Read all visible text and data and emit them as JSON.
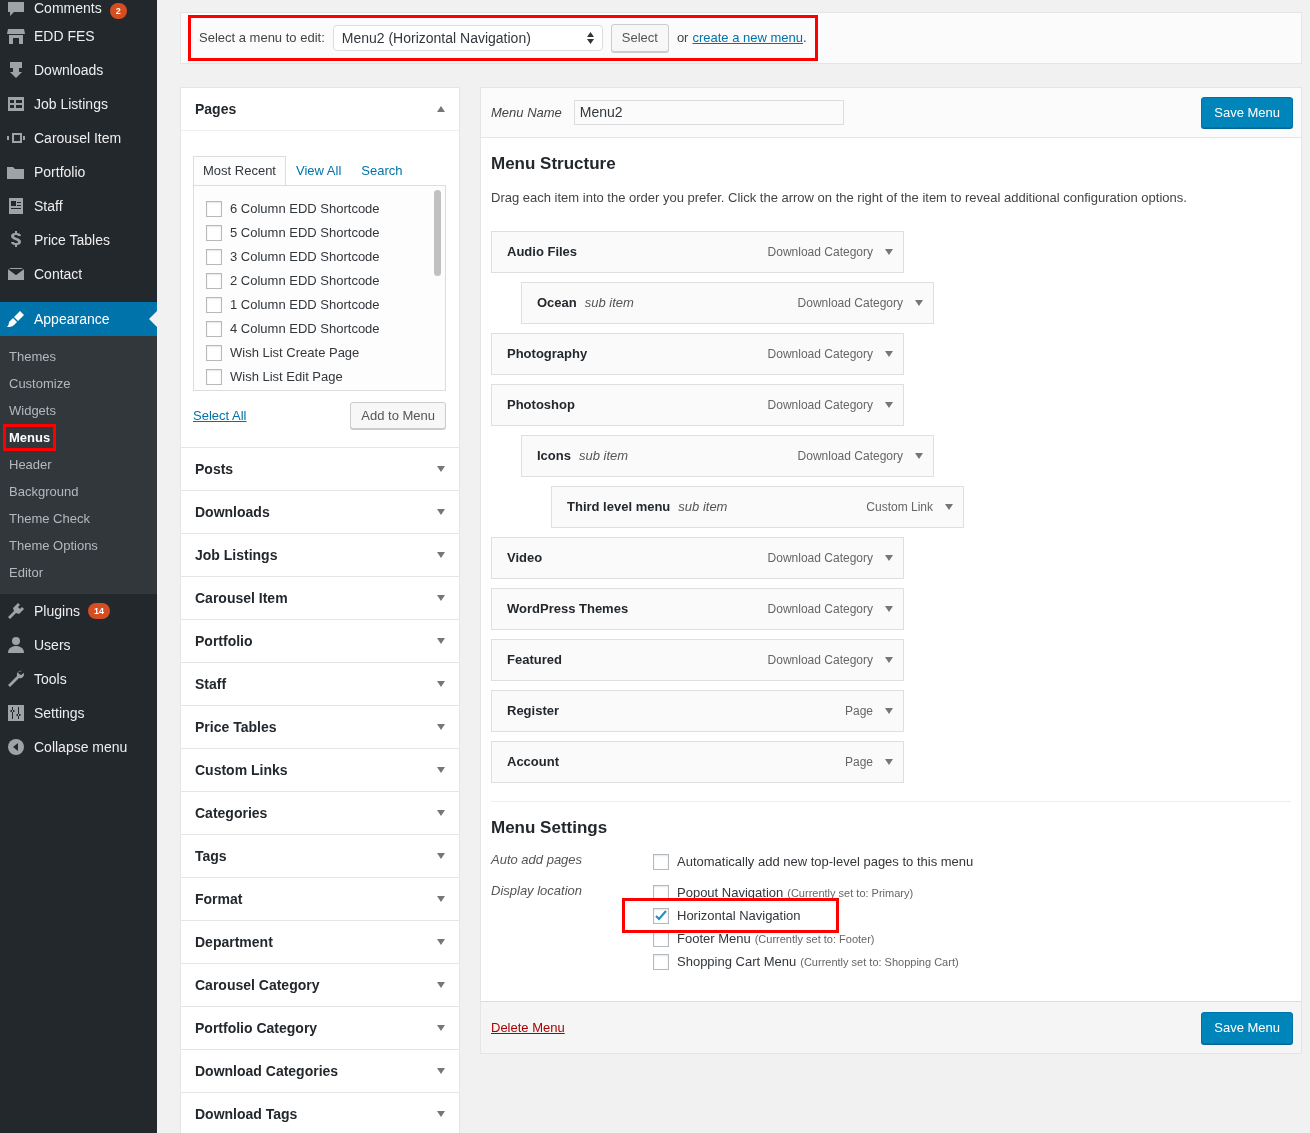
{
  "sidebar": {
    "items": [
      {
        "label": "Comments",
        "badge": "2",
        "selected": false
      },
      {
        "label": "EDD FES",
        "selected": false
      },
      {
        "label": "Downloads",
        "selected": false
      },
      {
        "label": "Job Listings",
        "selected": false
      },
      {
        "label": "Carousel Item",
        "selected": false
      },
      {
        "label": "Portfolio",
        "selected": false
      },
      {
        "label": "Staff",
        "selected": false
      },
      {
        "label": "Price Tables",
        "selected": false
      },
      {
        "label": "Contact",
        "selected": false
      },
      {
        "label": "Appearance",
        "selected": true,
        "children": [
          {
            "label": "Themes",
            "selected": false,
            "highlighted": false
          },
          {
            "label": "Customize",
            "selected": false,
            "highlighted": false
          },
          {
            "label": "Widgets",
            "selected": false,
            "highlighted": false
          },
          {
            "label": "Menus",
            "selected": true,
            "highlighted": true
          },
          {
            "label": "Header",
            "selected": false,
            "highlighted": false
          },
          {
            "label": "Background",
            "selected": false,
            "highlighted": false
          },
          {
            "label": "Theme Check",
            "selected": false,
            "highlighted": false
          },
          {
            "label": "Theme Options",
            "selected": false,
            "highlighted": false
          },
          {
            "label": "Editor",
            "selected": false,
            "highlighted": false
          }
        ]
      },
      {
        "label": "Plugins",
        "badge": "14",
        "selected": false
      },
      {
        "label": "Users",
        "selected": false
      },
      {
        "label": "Tools",
        "selected": false
      },
      {
        "label": "Settings",
        "selected": false
      },
      {
        "label": "Collapse menu",
        "selected": false
      }
    ]
  },
  "menu_select": {
    "label": "Select a menu to edit:",
    "value": "Menu2 (Horizontal Navigation)",
    "button": "Select",
    "or_text": "or",
    "link": "create a new menu",
    "end": ".",
    "highlighted": true
  },
  "add_items": {
    "sections": [
      {
        "title": "Pages",
        "expanded": true,
        "tabs": [
          {
            "label": "Most Recent",
            "selected": true
          },
          {
            "label": "View All",
            "selected": false
          },
          {
            "label": "Search",
            "selected": false
          }
        ],
        "items": [
          {
            "label": "6 Column EDD Shortcode",
            "checked": false
          },
          {
            "label": "5 Column EDD Shortcode",
            "checked": false
          },
          {
            "label": "3 Column EDD Shortcode",
            "checked": false
          },
          {
            "label": "2 Column EDD Shortcode",
            "checked": false
          },
          {
            "label": "1 Column EDD Shortcode",
            "checked": false
          },
          {
            "label": "4 Column EDD Shortcode",
            "checked": false
          },
          {
            "label": "Wish List Create Page",
            "checked": false
          },
          {
            "label": "Wish List Edit Page",
            "checked": false
          }
        ],
        "select_all": "Select All",
        "add_button": "Add to Menu"
      },
      {
        "title": "Posts",
        "expanded": false
      },
      {
        "title": "Downloads",
        "expanded": false
      },
      {
        "title": "Job Listings",
        "expanded": false
      },
      {
        "title": "Carousel Item",
        "expanded": false
      },
      {
        "title": "Portfolio",
        "expanded": false
      },
      {
        "title": "Staff",
        "expanded": false
      },
      {
        "title": "Price Tables",
        "expanded": false
      },
      {
        "title": "Custom Links",
        "expanded": false
      },
      {
        "title": "Categories",
        "expanded": false
      },
      {
        "title": "Tags",
        "expanded": false
      },
      {
        "title": "Format",
        "expanded": false
      },
      {
        "title": "Department",
        "expanded": false
      },
      {
        "title": "Carousel Category",
        "expanded": false
      },
      {
        "title": "Portfolio Category",
        "expanded": false
      },
      {
        "title": "Download Categories",
        "expanded": false
      },
      {
        "title": "Download Tags",
        "expanded": false
      }
    ]
  },
  "editor": {
    "name_label": "Menu Name",
    "name_value": "Menu2",
    "save_button": "Save Menu",
    "structure_title": "Menu Structure",
    "structure_hint": "Drag each item into the order you prefer. Click the arrow on the right of the item to reveal additional configuration options.",
    "items": [
      {
        "title": "Audio Files",
        "type": "Download Category",
        "children": [
          {
            "title": "Ocean",
            "note": "sub item",
            "type": "Download Category"
          }
        ]
      },
      {
        "title": "Photography",
        "type": "Download Category"
      },
      {
        "title": "Photoshop",
        "type": "Download Category",
        "children": [
          {
            "title": "Icons",
            "note": "sub item",
            "type": "Download Category",
            "children": [
              {
                "title": "Third level menu",
                "note": "sub item",
                "type": "Custom Link"
              }
            ]
          }
        ]
      },
      {
        "title": "Video",
        "type": "Download Category"
      },
      {
        "title": "WordPress Themes",
        "type": "Download Category"
      },
      {
        "title": "Featured",
        "type": "Download Category"
      },
      {
        "title": "Register",
        "type": "Page"
      },
      {
        "title": "Account",
        "type": "Page"
      }
    ],
    "settings_title": "Menu Settings",
    "settings": [
      {
        "label": "Auto add pages",
        "options": [
          {
            "label": "Automatically add new top-level pages to this menu",
            "checked": false,
            "highlighted": false
          }
        ]
      },
      {
        "label": "Display location",
        "options": [
          {
            "label": "Popout Navigation",
            "note": "(Currently set to: Primary)",
            "checked": false,
            "highlighted": false
          },
          {
            "label": "Horizontal Navigation",
            "checked": true,
            "highlighted": true
          },
          {
            "label": "Footer Menu",
            "note": "(Currently set to: Footer)",
            "checked": false,
            "highlighted": false
          },
          {
            "label": "Shopping Cart Menu",
            "note": "(Currently set to: Shopping Cart)",
            "checked": false,
            "highlighted": false
          }
        ]
      }
    ],
    "delete_link": "Delete Menu",
    "footer_save_button": "Save Menu"
  }
}
